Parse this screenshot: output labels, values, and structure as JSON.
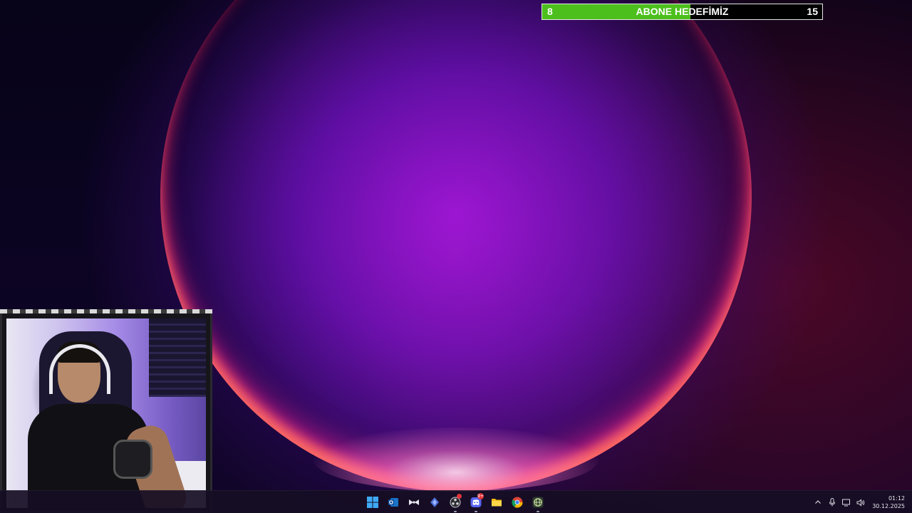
{
  "goal": {
    "current": "8",
    "title": "ABONE HEDEFİMİZ",
    "target": "15",
    "progress_fraction": 0.53,
    "fill_color": "#4cbf1d"
  },
  "webcam": {
    "description_icon": "webcam-overlay"
  },
  "taskbar": {
    "apps": [
      {
        "id": "start",
        "icon": "windows-start-icon",
        "running": false
      },
      {
        "id": "outlook",
        "icon": "outlook-icon",
        "running": false
      },
      {
        "id": "app3",
        "icon": "bowtie-app-icon",
        "running": false
      },
      {
        "id": "app4",
        "icon": "diamond-app-icon",
        "running": false
      },
      {
        "id": "obs",
        "icon": "obs-icon",
        "running": true,
        "badge": ""
      },
      {
        "id": "discord",
        "icon": "discord-icon",
        "running": true,
        "badge": "9+"
      },
      {
        "id": "explorer",
        "icon": "folder-icon",
        "running": false
      },
      {
        "id": "chrome",
        "icon": "chrome-icon",
        "running": false
      },
      {
        "id": "app9",
        "icon": "globe-app-icon",
        "running": true
      }
    ],
    "tray": {
      "chevron": "chevron-up-icon",
      "mic": "microphone-icon",
      "display": "display-icon",
      "volume": "volume-icon",
      "time": "01:12",
      "date": "30.12.2025"
    }
  },
  "colors": {
    "taskbar_bg": "#160e24",
    "badge": "#e0353a"
  }
}
